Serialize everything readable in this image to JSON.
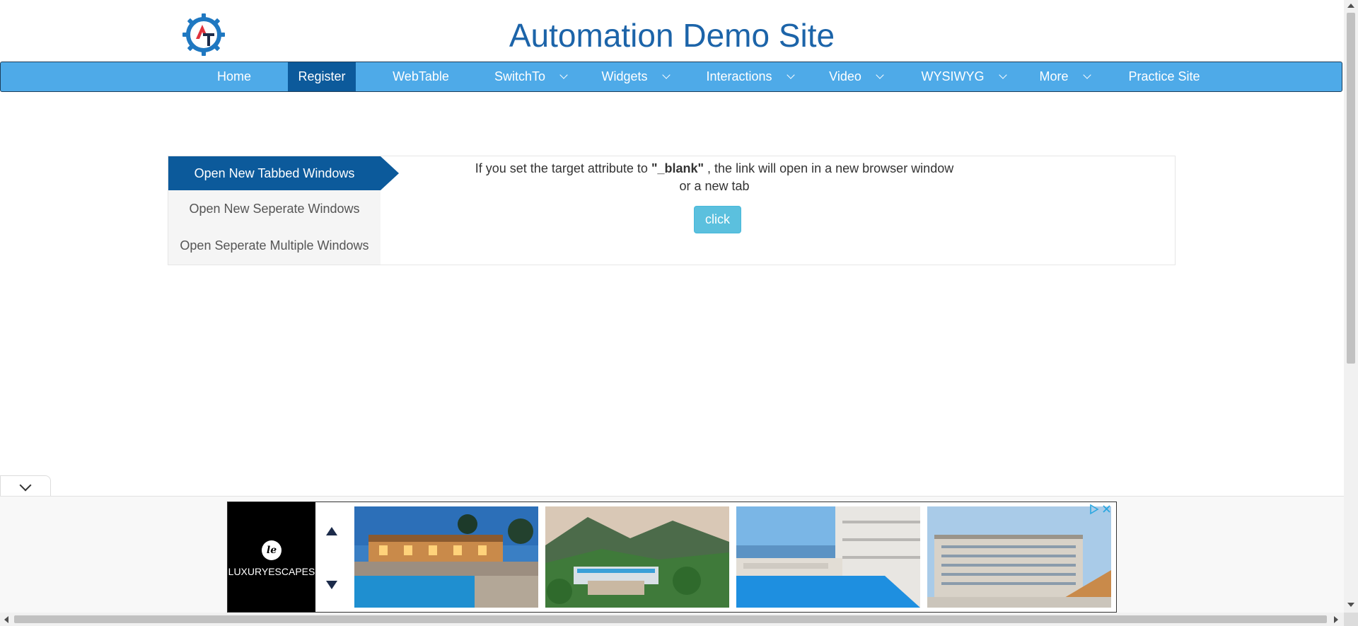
{
  "header": {
    "title": "Automation Demo Site",
    "logo_icon": "automation-gear-logo"
  },
  "nav": {
    "items": [
      {
        "label": "Home",
        "dropdown": false,
        "active": false
      },
      {
        "label": "Register",
        "dropdown": false,
        "active": true
      },
      {
        "label": "WebTable",
        "dropdown": false,
        "active": false
      },
      {
        "label": "SwitchTo",
        "dropdown": true,
        "active": false
      },
      {
        "label": "Widgets",
        "dropdown": true,
        "active": false
      },
      {
        "label": "Interactions",
        "dropdown": true,
        "active": false
      },
      {
        "label": "Video",
        "dropdown": true,
        "active": false
      },
      {
        "label": "WYSIWYG",
        "dropdown": true,
        "active": false
      },
      {
        "label": "More",
        "dropdown": true,
        "active": false
      },
      {
        "label": "Practice Site",
        "dropdown": false,
        "active": false
      }
    ]
  },
  "tabs": {
    "items": [
      {
        "label": "Open New Tabbed Windows",
        "active": true
      },
      {
        "label": "Open New Seperate Windows",
        "active": false
      },
      {
        "label": "Open Seperate Multiple Windows",
        "active": false
      }
    ]
  },
  "content": {
    "desc_before": "If you set the target attribute to",
    "desc_code": "\"_blank\"",
    "desc_after": ", the link will open in a new browser window",
    "desc_line2": "or a new tab",
    "button_label": "click"
  },
  "ad": {
    "brand": "LUXURYESCAPES",
    "brand_monogram": "le",
    "thumbnails": [
      "resort-pool-night",
      "mountain-resort",
      "seaside-pool-hotel",
      "city-hotel-building"
    ]
  },
  "colors": {
    "title": "#1c64a9",
    "navbar": "#4eaae8",
    "nav_active": "#0c5a9b",
    "button": "#5bc0de"
  }
}
